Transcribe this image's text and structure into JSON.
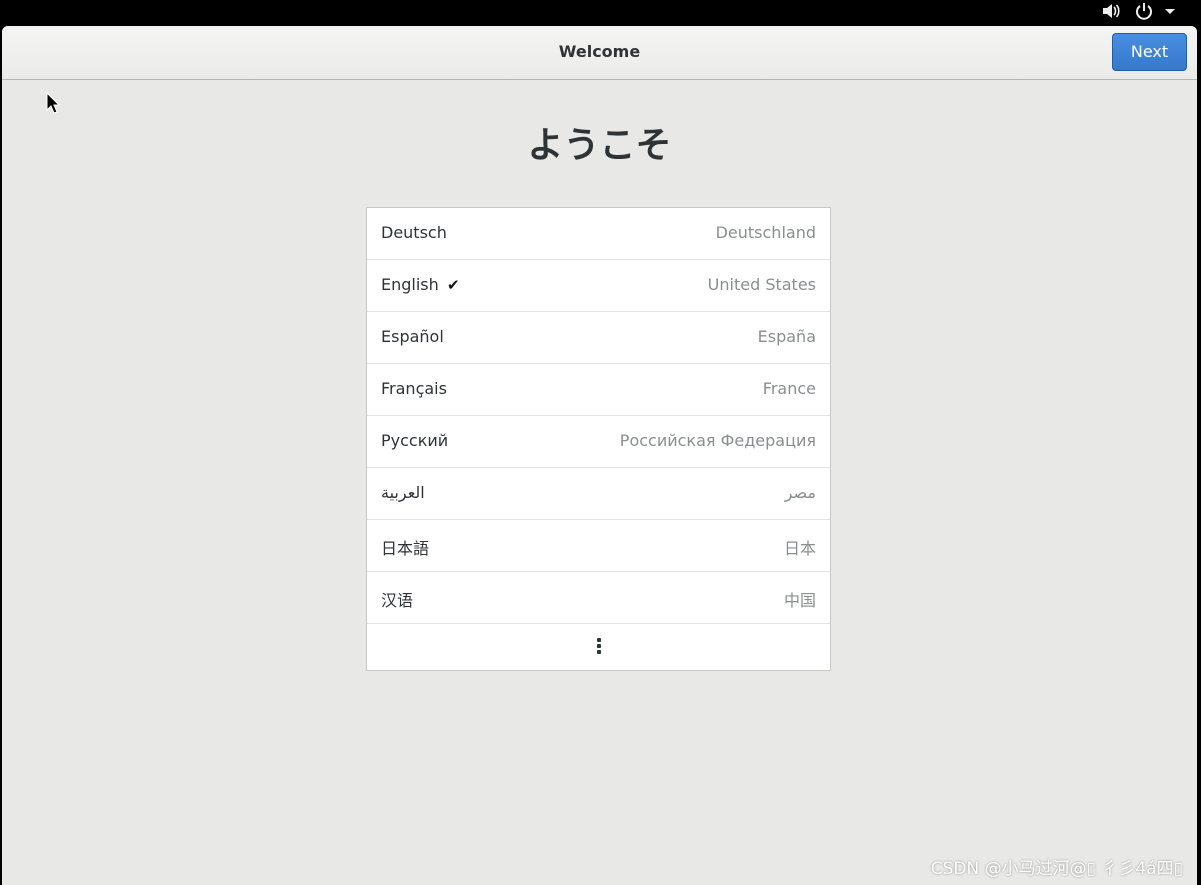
{
  "topbar": {
    "icons": [
      "volume-icon",
      "power-icon",
      "menu-arrow-icon"
    ]
  },
  "window": {
    "title": "Welcome",
    "next_label": "Next"
  },
  "welcome_heading": "ようこそ",
  "languages": [
    {
      "language": "Deutsch",
      "region": "Deutschland",
      "selected": false
    },
    {
      "language": "English",
      "region": "United States",
      "selected": true
    },
    {
      "language": "Español",
      "region": "España",
      "selected": false
    },
    {
      "language": "Français",
      "region": "France",
      "selected": false
    },
    {
      "language": "Русский",
      "region": "Российская Федерация",
      "selected": false
    },
    {
      "language": "العربية",
      "region": "مصر",
      "selected": false
    },
    {
      "language": "日本語",
      "region": "日本",
      "selected": false
    },
    {
      "language": "汉语",
      "region": "中国",
      "selected": false
    }
  ],
  "check_glyph": "✔",
  "more_icon": "vertical-ellipsis-icon",
  "watermark": "CSDN @小马过河@▯ 彳彡4á四▯",
  "colors": {
    "accent": "#3a7fd5",
    "background": "#e8e8e7",
    "secondary_text": "#8b8e8f"
  }
}
